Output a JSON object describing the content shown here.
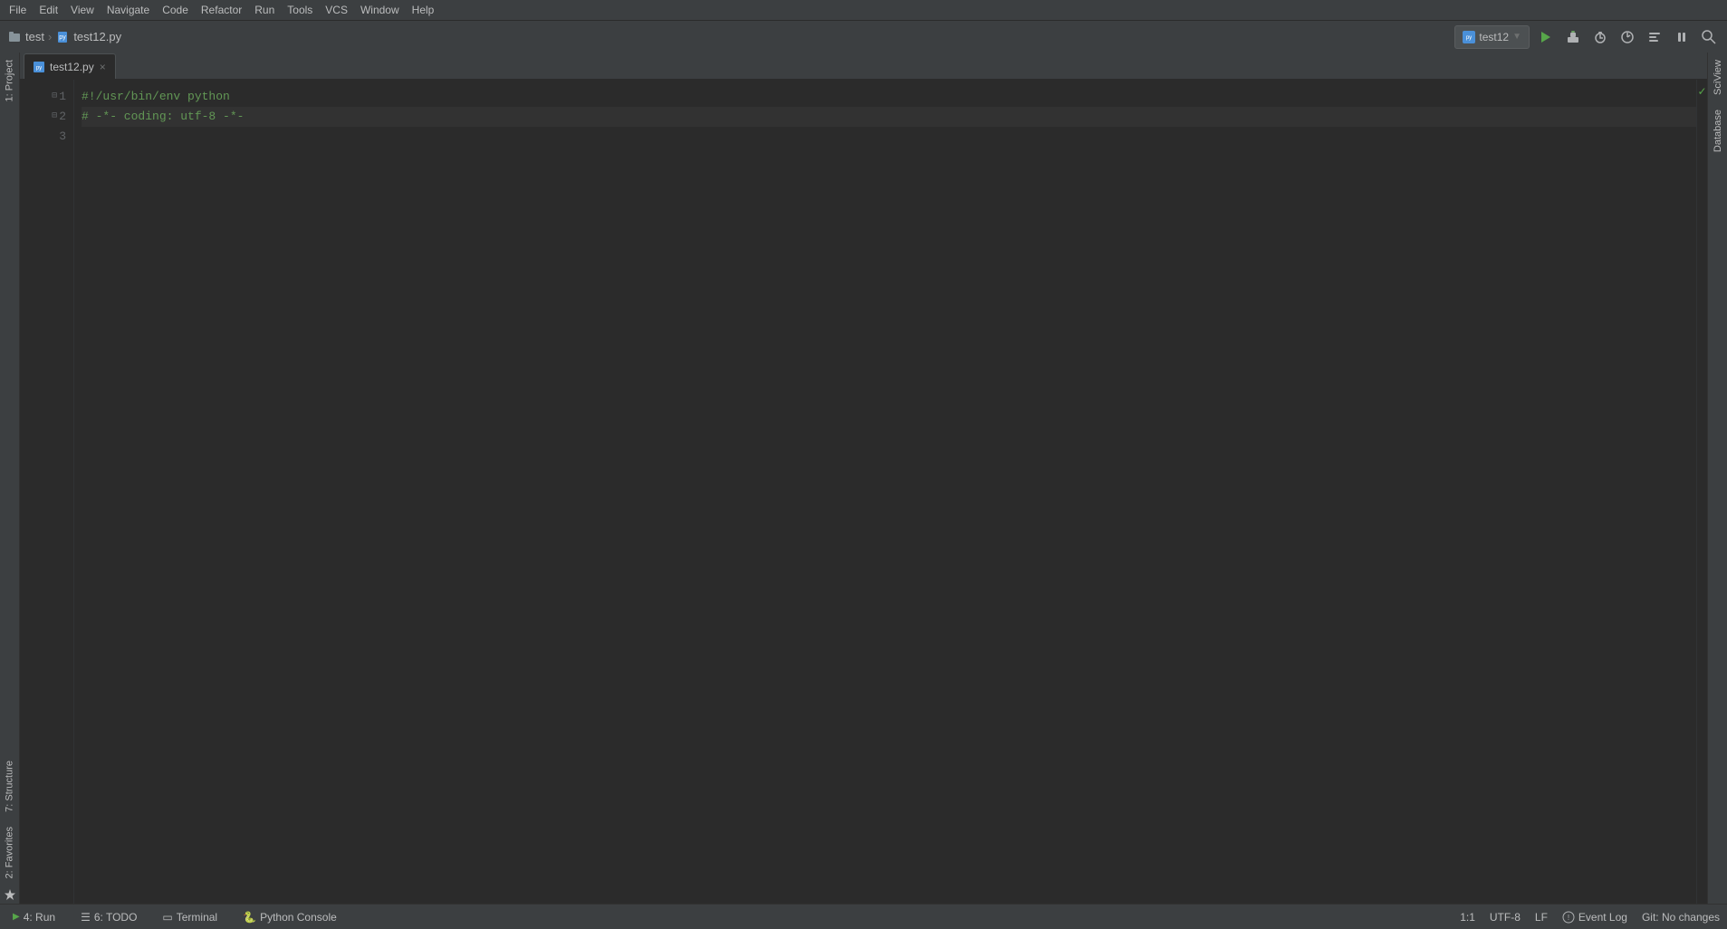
{
  "menu": {
    "items": [
      "File",
      "Edit",
      "View",
      "Navigate",
      "Code",
      "Refactor",
      "Run",
      "Tools",
      "VCS",
      "Window",
      "Help"
    ]
  },
  "toolbar": {
    "breadcrumb": {
      "project": "test",
      "separator": "›",
      "file": "test12.py"
    },
    "run_config": {
      "label": "test12",
      "arrow": "▼"
    },
    "buttons": {
      "run": "▶",
      "build": "🔨",
      "debug": "🐞",
      "profile": "⏱",
      "coverage": "≡",
      "pause": "⏸"
    },
    "search": "🔍"
  },
  "editor": {
    "tab": {
      "name": "test12.py",
      "close": "×"
    },
    "lines": [
      {
        "number": 1,
        "content": "#!/usr/bin/env python",
        "type": "shebang"
      },
      {
        "number": 2,
        "content": "# -*- coding: utf-8 -*-",
        "type": "comment"
      },
      {
        "number": 3,
        "content": "",
        "type": "empty"
      }
    ],
    "gutter_check": "✓"
  },
  "sidebar_left": {
    "tabs": [
      "1: Project",
      "7: Structure",
      "2: Favorites"
    ]
  },
  "sidebar_right": {
    "tabs": [
      "SciView",
      "Database"
    ]
  },
  "status_bar": {
    "items": [
      {
        "icon": "▶",
        "label": "4: Run"
      },
      {
        "icon": "≡",
        "label": "6: TODO"
      },
      {
        "icon": "▭",
        "label": "Terminal"
      },
      {
        "icon": "🐍",
        "label": "Python Console"
      }
    ],
    "right_items": [
      {
        "label": "Event Log"
      }
    ],
    "position": "1:1",
    "encoding": "UTF-8",
    "line_ending": "LF",
    "git": "Git: No changes"
  }
}
